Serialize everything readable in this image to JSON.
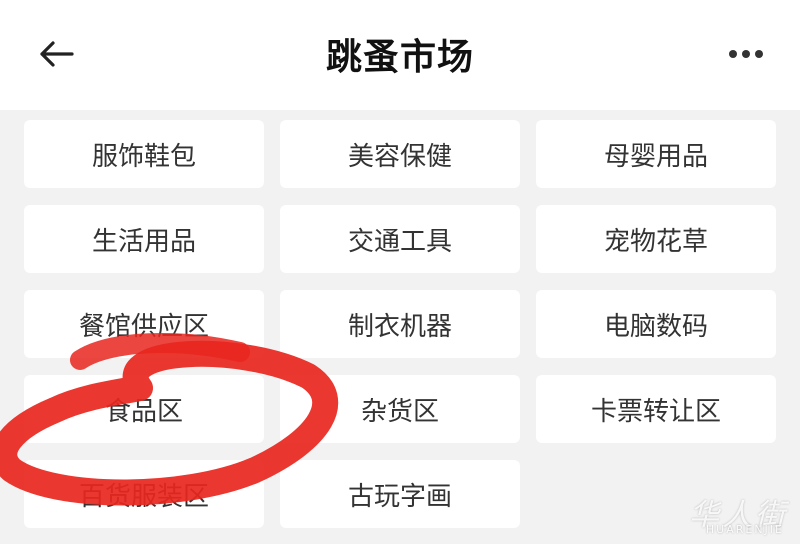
{
  "header": {
    "title": "跳蚤市场",
    "back_icon": "arrow-left-icon",
    "more_icon": "more-dots-icon"
  },
  "categories": [
    [
      "服饰鞋包",
      "美容保健",
      "母婴用品"
    ],
    [
      "生活用品",
      "交通工具",
      "宠物花草"
    ],
    [
      "餐馆供应区",
      "制衣机器",
      "电脑数码"
    ],
    [
      "食品区",
      "杂货区",
      "卡票转让区"
    ],
    [
      "百货服装区",
      "古玩字画"
    ]
  ],
  "annotation": {
    "color": "#e8261e",
    "target": "食品区"
  },
  "watermark": {
    "logo_text": "华人街",
    "sub_text": "HUARENJIE"
  }
}
